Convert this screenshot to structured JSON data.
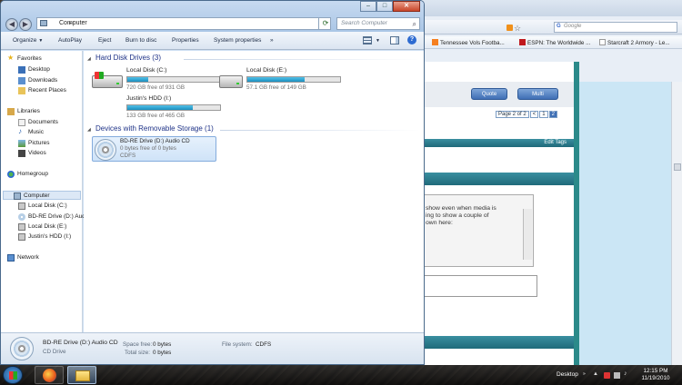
{
  "window": {
    "address": "Computer",
    "search_placeholder": "Search Computer",
    "controls": {
      "minimize": "–",
      "maximize": "□",
      "close": "✕"
    }
  },
  "toolbar": {
    "items": [
      "Organize",
      "AutoPlay",
      "Eject",
      "Burn to disc",
      "Properties",
      "System properties",
      "»"
    ]
  },
  "nav": {
    "favorites": "Favorites",
    "desktop": "Desktop",
    "downloads": "Downloads",
    "recent": "Recent Places",
    "libraries": "Libraries",
    "documents": "Documents",
    "music": "Music",
    "pictures": "Pictures",
    "videos": "Videos",
    "homegroup": "Homegroup",
    "computer": "Computer",
    "drive_c": "Local Disk (C:)",
    "drive_d": "BD-RE Drive (D:) Audio CD",
    "drive_e": "Local Disk (E:)",
    "drive_f": "Justin's HDD (I:)",
    "network": "Network"
  },
  "content": {
    "hdd_group": "Hard Disk Drives (3)",
    "removable_group": "Devices with Removable Storage (1)",
    "drives": [
      {
        "name": "Local Disk (C:)",
        "free": "720 GB free of 931 GB",
        "used_fraction": 0.23
      },
      {
        "name": "Local Disk (E:)",
        "free": "57.1 GB free of 149 GB",
        "used_fraction": 0.62
      },
      {
        "name": "Justin's HDD (I:)",
        "free": "133 GB free of 465 GB",
        "used_fraction": 0.71
      }
    ],
    "device": {
      "name": "BD-RE Drive (D:) Audio CD",
      "free": "0 bytes free of 0 bytes",
      "fs": "CDFS"
    }
  },
  "details": {
    "name": "BD-RE Drive (D:) Audio CD",
    "type": "CD Drive",
    "space_free_label": "Space free:",
    "space_free": "0 bytes",
    "total_size_label": "Total size:",
    "total_size": "0 bytes",
    "fs_label": "File system:",
    "fs": "CDFS"
  },
  "browser": {
    "search_placeholder": "Google",
    "bookmarks": [
      "Tennessee Vols Footba...",
      "ESPN: The Worldwide ...",
      "Starcraft 2 Armory - Le..."
    ],
    "quote_btn": "Quote",
    "multi_btn": "Multi",
    "pager_label": "Page 2 of 2",
    "pager": [
      "<",
      "1",
      "2"
    ],
    "edit_tags": "Edit Tags",
    "quote_lines": [
      "show even when media is",
      "ing to show a couple of",
      "",
      "own here:"
    ]
  },
  "taskbar": {
    "desktop_label": "Desktop",
    "time": "12:15 PM",
    "date": "11/19/2010"
  }
}
